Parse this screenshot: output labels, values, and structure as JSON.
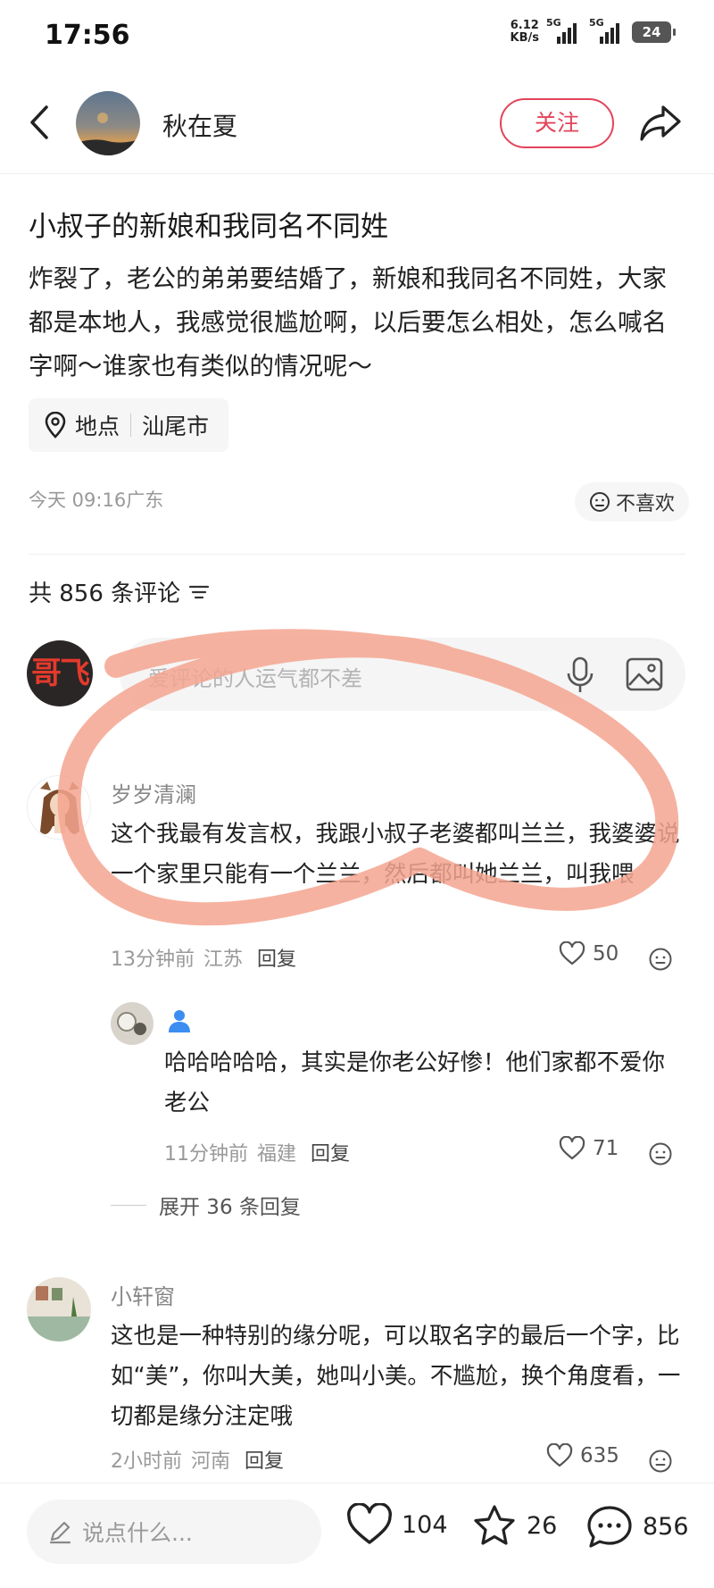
{
  "status_bar": {
    "time": "17:56",
    "net_speed_value": "6.12",
    "net_speed_unit": "KB/s",
    "sim1_label": "5G",
    "sim2_label": "5G",
    "battery": "24"
  },
  "header": {
    "author_name": "秋在夏",
    "follow_label": "关注"
  },
  "post": {
    "title": "小叔子的新娘和我同名不同姓",
    "body": "炸裂了，老公的弟弟要结婚了，新娘和我同名不同姓，大家都是本地人，我感觉很尴尬啊，以后要怎么相处，怎么喊名字啊～谁家也有类似的情况呢～",
    "location_label": "地点",
    "location_value": "汕尾市",
    "meta": "今天 09:16广东",
    "dislike_label": "不喜欢"
  },
  "comments_header": {
    "count_text": "共 856 条评论"
  },
  "comment_input": {
    "avatar_text": "哥飞",
    "placeholder": "爱评论的人运气都不差"
  },
  "comments": [
    {
      "user": "岁岁清澜",
      "text": "这个我最有发言权，我跟小叔子老婆都叫兰兰，我婆婆说一个家里只能有一个兰兰，然后都叫她兰兰，叫我喂",
      "time": "13分钟前",
      "region": "江苏",
      "reply_label": "回复",
      "likes": "50"
    },
    {
      "user": "",
      "text": "哈哈哈哈哈，其实是你老公好惨！他们家都不爱你老公",
      "time": "11分钟前",
      "region": "福建",
      "reply_label": "回复",
      "likes": "71"
    },
    {
      "user": "小轩窗",
      "text": "这也是一种特别的缘分呢，可以取名字的最后一个字，比如“美”，你叫大美，她叫小美。不尴尬，换个角度看，一切都是缘分注定哦",
      "time": "2小时前",
      "region": "河南",
      "reply_label": "回复",
      "likes": "635"
    }
  ],
  "expand_replies": "展开 36 条回复",
  "bottom_bar": {
    "input_placeholder": "说点什么...",
    "likes": "104",
    "favorites": "26",
    "comments": "856"
  },
  "colors": {
    "accent_red": "#e2445a",
    "scribble": "#f4a58f"
  }
}
